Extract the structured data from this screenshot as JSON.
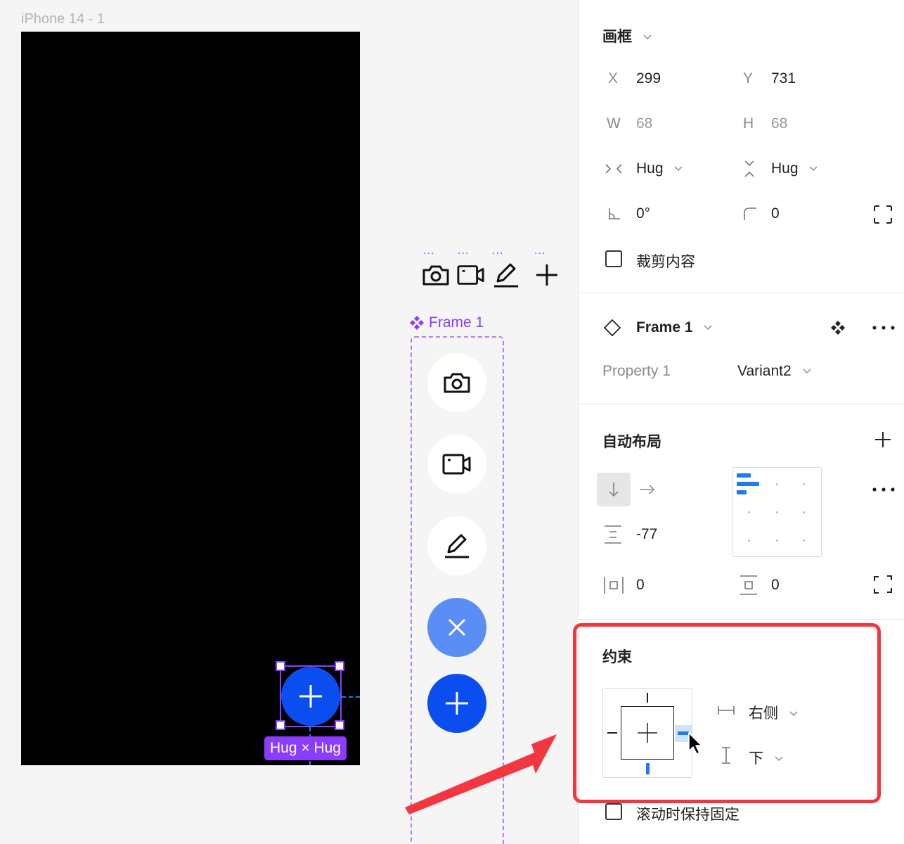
{
  "canvas": {
    "frame_title": "iPhone 14 - 1",
    "selection_badge": "Hug × Hug",
    "component_set_label": "Frame 1",
    "dot_markers": [
      "...",
      "...",
      "...",
      "..."
    ]
  },
  "panel": {
    "frame": {
      "title": "画框",
      "x_label": "X",
      "x_value": "299",
      "y_label": "Y",
      "y_value": "731",
      "w_label": "W",
      "w_value": "68",
      "h_label": "H",
      "h_value": "68",
      "width_mode": "Hug",
      "height_mode": "Hug",
      "rotation": "0°",
      "corner_radius": "0",
      "clip_content_label": "裁剪内容"
    },
    "instance": {
      "name": "Frame 1",
      "property_label": "Property 1",
      "property_value": "Variant2"
    },
    "auto_layout": {
      "title": "自动布局",
      "gap": "-77",
      "horizontal_padding": "0",
      "vertical_padding": "0"
    },
    "constraints": {
      "title": "约束",
      "horizontal": "右侧",
      "vertical": "下",
      "fix_on_scroll_label": "滚动时保持固定"
    }
  },
  "colors": {
    "selection": "#8b3dff",
    "fab_blue": "#0a4ef0",
    "fab_light_blue": "#5b8df7",
    "highlight_red": "#f3363f",
    "constraint_blue": "#1e7bf0"
  }
}
